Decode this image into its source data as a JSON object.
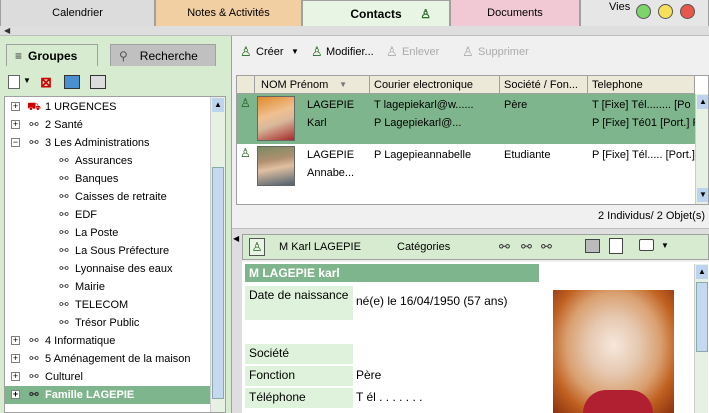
{
  "tabs": [
    {
      "label": "Calendrier"
    },
    {
      "label": "Notes & Activités"
    },
    {
      "label": "Contacts"
    },
    {
      "label": "Documents"
    },
    {
      "label": "Vies"
    }
  ],
  "left_panel": {
    "tab_groups": "Groupes",
    "tab_search": "Recherche",
    "tree": [
      {
        "label": "1 URGENCES",
        "level": 0,
        "expander": "+"
      },
      {
        "label": "2 Santé",
        "level": 0,
        "expander": "+"
      },
      {
        "label": "3  Les Administrations",
        "level": 0,
        "expander": "-"
      },
      {
        "label": "Assurances",
        "level": 1
      },
      {
        "label": "Banques",
        "level": 1
      },
      {
        "label": "Caisses de retraite",
        "level": 1
      },
      {
        "label": "EDF",
        "level": 1
      },
      {
        "label": "La Poste",
        "level": 1
      },
      {
        "label": "La Sous Préfecture",
        "level": 1
      },
      {
        "label": "Lyonnaise des eaux",
        "level": 1
      },
      {
        "label": "Mairie",
        "level": 1
      },
      {
        "label": "TELECOM",
        "level": 1
      },
      {
        "label": "Trésor Public",
        "level": 1
      },
      {
        "label": "4 Informatique",
        "level": 0,
        "expander": "+"
      },
      {
        "label": "5 Aménagement de la maison",
        "level": 0,
        "expander": "+"
      },
      {
        "label": "Culturel",
        "level": 0,
        "expander": "+"
      },
      {
        "label": "Famille LAGEPIE",
        "level": 0,
        "expander": "+",
        "selected": true
      }
    ]
  },
  "toolbar": {
    "create": "Créer",
    "modify": "Modifier...",
    "remove": "Enlever",
    "delete": "Supprimer"
  },
  "grid": {
    "columns": [
      "NOM Prénom",
      "Courier electronique",
      "Société / Fon...",
      "Telephone"
    ],
    "rows": [
      {
        "name": "LAGEPIE",
        "first": "Karl",
        "email1": "T lagepiekarl@w......",
        "email2": "P Lagepiekarl@...",
        "societe": "Père",
        "tel1": "T [Fixe] Tél........ [Po",
        "tel2": "P [Fixe] Té01 [Port.] F"
      },
      {
        "name": "LAGEPIE",
        "first": "Annabe...",
        "email1": "P Lagepieannabelle",
        "email2": "",
        "societe": "Etudiante",
        "tel1": "P [Fixe] Tél..... [Port.] F",
        "tel2": ""
      }
    ],
    "status": "2 Individus/ 2 Objet(s)"
  },
  "detail": {
    "header_name": "M Karl LAGEPIE",
    "categories_label": "Catégories",
    "title": "M LAGEPIE karl",
    "fields": [
      {
        "label": "Date de naissance",
        "value": "né(e) le 16/04/1950 (57 ans)"
      },
      {
        "label": "Société",
        "value": ""
      },
      {
        "label": "Fonction",
        "value": "Père"
      },
      {
        "label": "Téléphone",
        "value": "T él . . . . . . ."
      }
    ]
  },
  "colors": {
    "selected_row": "#7fb58c",
    "tab_notes": "#f2cfa3",
    "tab_contacts": "#e8f5e4",
    "tab_documents": "#f0c9d4",
    "detail_title": "#7fb58c"
  }
}
